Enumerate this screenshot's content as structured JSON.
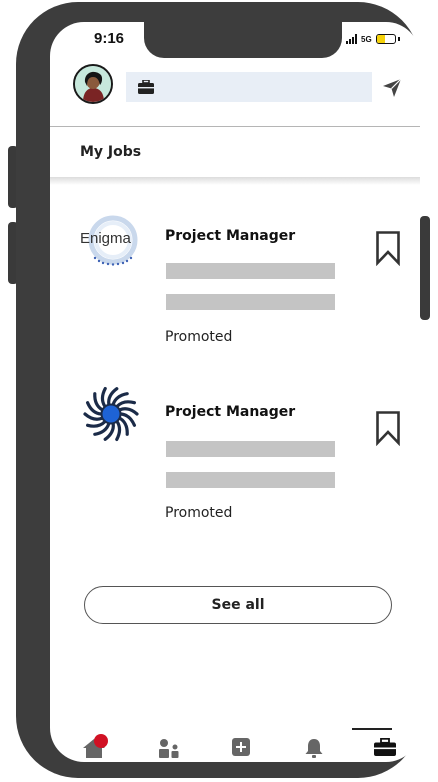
{
  "status_bar": {
    "time": "9:16",
    "network": "5G"
  },
  "header": {
    "search_icon": "briefcase-icon",
    "message_icon": "send-icon"
  },
  "section": {
    "title": "My Jobs"
  },
  "jobs": [
    {
      "company_logo_text": "Enigma",
      "title": "Project Manager",
      "status": "Promoted",
      "bookmark_icon": "bookmark-outline-icon"
    },
    {
      "company_logo_text": "",
      "title": "Project Manager",
      "status": "Promoted",
      "bookmark_icon": "bookmark-outline-icon"
    }
  ],
  "see_all": {
    "label": "See all"
  },
  "tabs": [
    {
      "icon": "home-icon",
      "has_badge": true
    },
    {
      "icon": "my-network-icon",
      "has_badge": false
    },
    {
      "icon": "post-icon",
      "has_badge": false
    },
    {
      "icon": "notifications-bell-icon",
      "has_badge": false
    },
    {
      "icon": "jobs-briefcase-icon",
      "active": true
    }
  ],
  "colors": {
    "frame": "#3d3d3d",
    "search_bg": "#e8eef6",
    "placeholder": "#c4c4c4",
    "badge": "#d11124",
    "battery": "#f5d20a",
    "logo_blue": "#1e63d6"
  }
}
